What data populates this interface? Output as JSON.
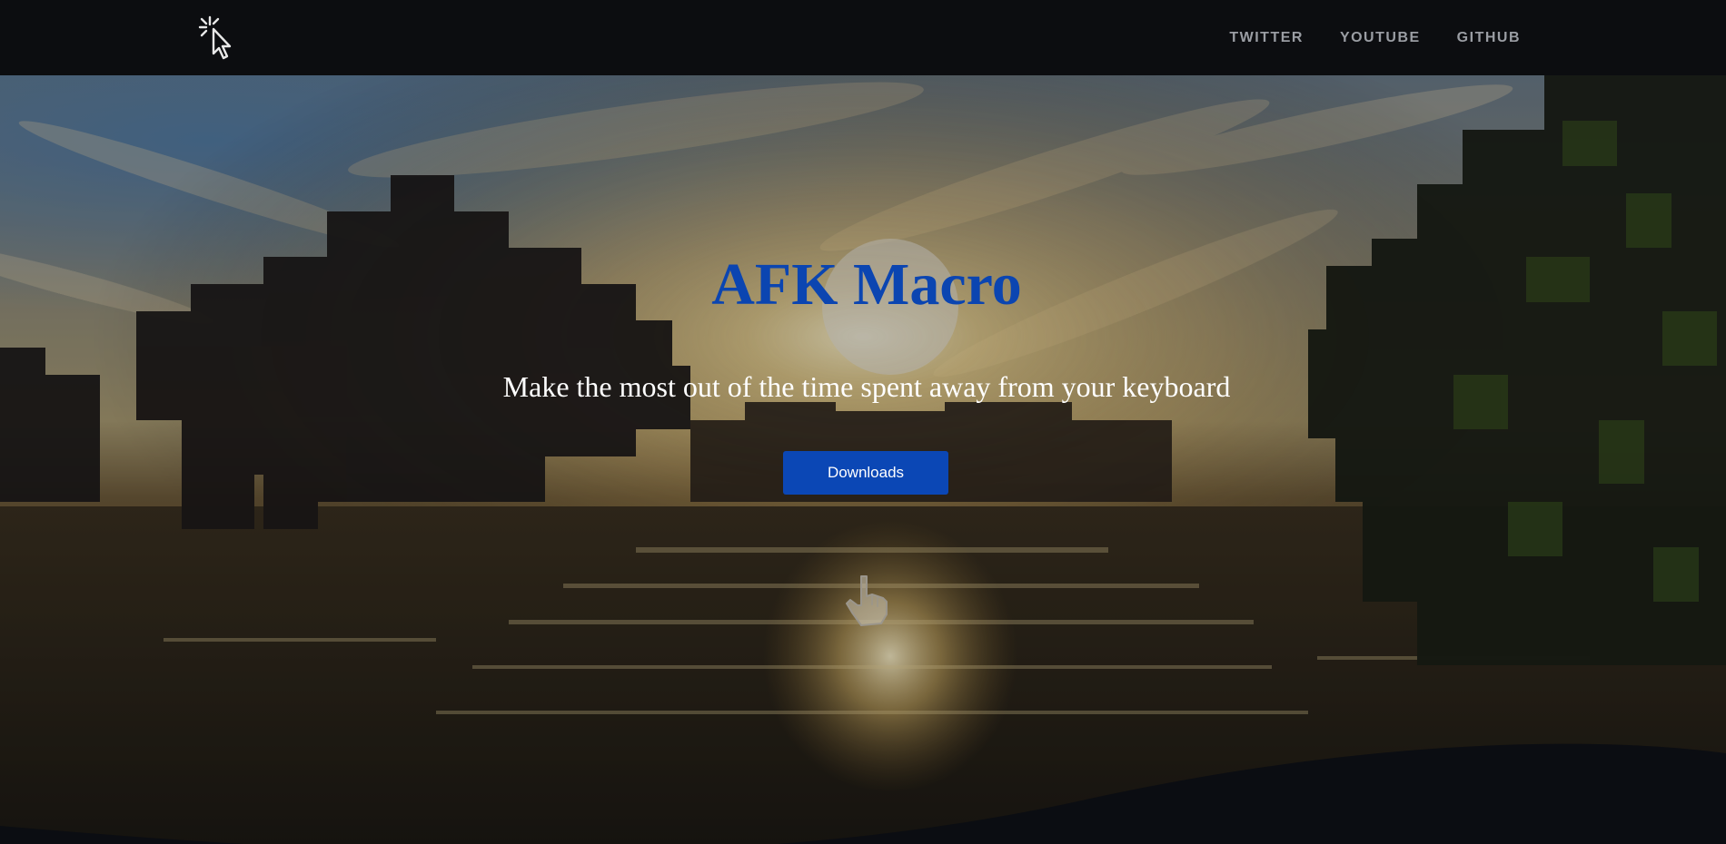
{
  "nav": {
    "logo_icon": "cursor-click-icon",
    "links": [
      {
        "label": "TWITTER"
      },
      {
        "label": "YOUTUBE"
      },
      {
        "label": "GITHUB"
      }
    ]
  },
  "hero": {
    "title": "AFK Macro",
    "subtitle": "Make the most out of the time spent away from your keyboard",
    "button_label": "Downloads",
    "background": "sunset-lake-minecraft-landscape",
    "pointer_icon": "pointing-hand-icon"
  },
  "colors": {
    "navbar_bg": "#0c0d10",
    "title": "#0b45b1",
    "button_bg": "#0b47b5",
    "nav_link": "#9a9da3",
    "footer_bg": "#0b0d12"
  }
}
